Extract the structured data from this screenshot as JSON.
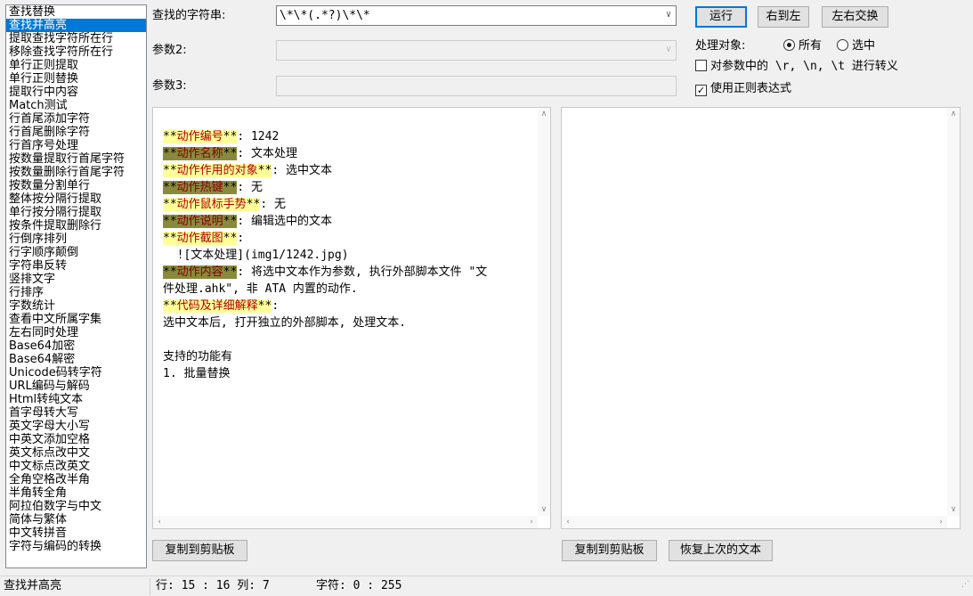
{
  "function_list": {
    "selected_index": 1,
    "items": [
      "查找替换",
      "查找并高亮",
      "提取查找字符所在行",
      "移除查找字符所在行",
      "单行正则提取",
      "单行正则替换",
      "提取行中内容",
      "Match测试",
      "行首尾添加字符",
      "行首尾删除字符",
      "行首序号处理",
      "按数量提取行首尾字符",
      "按数量删除行首尾字符",
      "按数量分割单行",
      "整体按分隔行提取",
      "单行按分隔行提取",
      "按条件提取删除行",
      "行倒序排列",
      "行字顺序颠倒",
      "字符串反转",
      "竖排文字",
      "行排序",
      "字数统计",
      "查看中文所属字集",
      "左右同时处理",
      "Base64加密",
      "Base64解密",
      "Unicode码转字符",
      "URL编码与解码",
      "Html转纯文本",
      "首字母转大写",
      "英文字母大小写",
      "中英文添加空格",
      "英文标点改中文",
      "中文标点改英文",
      "全角空格改半角",
      "半角转全角",
      "阿拉伯数字与中文",
      "简体与繁体",
      "中文转拼音",
      "字符与编码的转换"
    ]
  },
  "params": {
    "search_label": "查找的字符串:",
    "search_value": "\\*\\*(.*?)\\*\\*",
    "param2_label": "参数2:",
    "param2_value": "",
    "param3_label": "参数3:",
    "param3_value": ""
  },
  "buttons": {
    "run": "运行",
    "right_to_left": "右到左",
    "swap": "左右交换",
    "copy_left": "复制到剪贴板",
    "copy_right": "复制到剪贴板",
    "restore": "恢复上次的文本"
  },
  "options": {
    "target_label": "处理对象:",
    "radio_all": "所有",
    "radio_selected": "选中",
    "radio_value": "all",
    "escape_label": "对参数中的 \\r, \\n, \\t 进行转义",
    "escape_checked": false,
    "regex_label": "使用正则表达式",
    "regex_checked": true
  },
  "editor_left": {
    "lines": [
      {
        "k": "动作编号",
        "rest": ": 1242",
        "style": "light"
      },
      {
        "k": "动作名称",
        "rest": ": 文本处理",
        "style": "dark"
      },
      {
        "k": "动作作用的对象",
        "rest": ": 选中文本",
        "style": "light"
      },
      {
        "k": "动作热键",
        "rest": ": 无",
        "style": "dark"
      },
      {
        "k": "动作鼠标手势",
        "rest": ": 无",
        "style": "light"
      },
      {
        "k": "动作说明",
        "rest": ": 编辑选中的文本",
        "style": "dark"
      },
      {
        "k": "动作截图",
        "rest": ":",
        "style": "light"
      },
      {
        "text": "  ![文本处理](img1/1242.jpg)"
      },
      {
        "k": "动作内容",
        "rest": ": 将选中文本作为参数, 执行外部脚本文件 \"文",
        "style": "dark"
      },
      {
        "text": "件处理.ahk\", 非 ATA 内置的动作."
      },
      {
        "k": "代码及详细解释",
        "rest": ":",
        "style": "light"
      },
      {
        "text": "选中文本后, 打开独立的外部脚本, 处理文本."
      },
      {
        "text": ""
      },
      {
        "text": "支持的功能有"
      },
      {
        "text": "1. 批量替换"
      }
    ]
  },
  "editor_right": {
    "text": ""
  },
  "statusbar": {
    "action": "查找并高亮",
    "position": "行: 15 : 16 列: 7",
    "chars": "字符: 0 : 255"
  }
}
